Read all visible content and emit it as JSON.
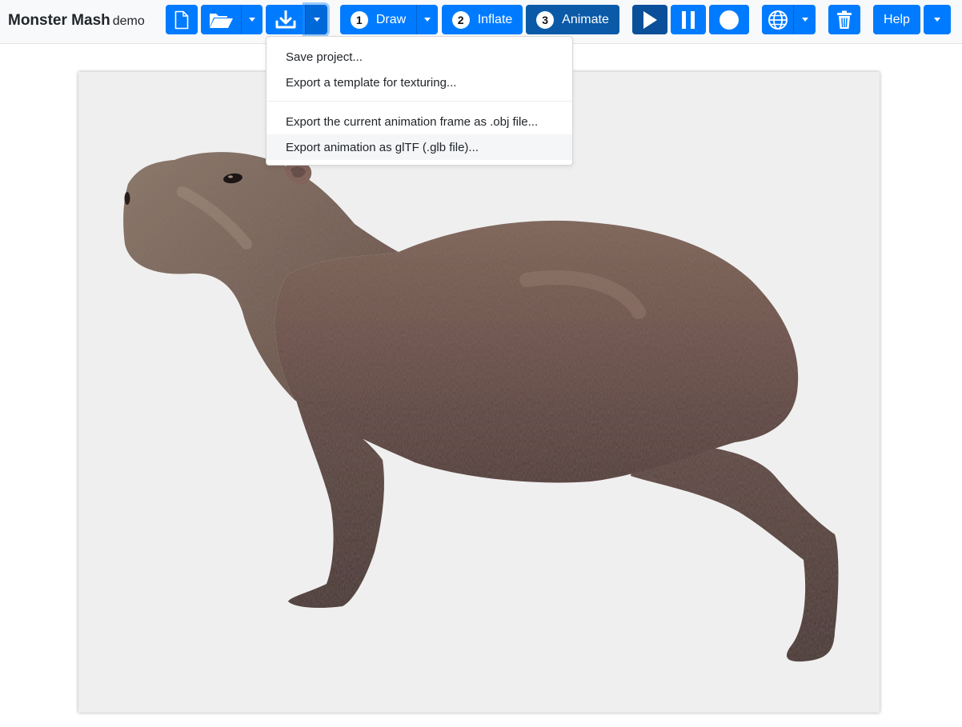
{
  "app": {
    "title": "Monster Mash",
    "subtitle": "demo"
  },
  "toolbar": {
    "new_icon": "new-document-icon",
    "open_icon": "folder-open-icon",
    "save_icon": "download-icon",
    "steps": [
      {
        "number": "1",
        "label": "Draw"
      },
      {
        "number": "2",
        "label": "Inflate"
      },
      {
        "number": "3",
        "label": "Animate"
      }
    ],
    "play_icon": "play-icon",
    "pause_icon": "pause-icon",
    "record_icon": "record-icon",
    "language_icon": "globe-icon",
    "delete_icon": "trash-icon",
    "help_label": "Help"
  },
  "save_menu": {
    "items": [
      "Save project...",
      "Export a template for texturing...",
      "Export the current animation frame as .obj file...",
      "Export animation as glTF (.glb file)..."
    ]
  },
  "colors": {
    "primary": "#007bff",
    "active": "#0b5aa8",
    "canvas_bg": "#efefef",
    "navbar_bg": "#f8f9fa"
  }
}
